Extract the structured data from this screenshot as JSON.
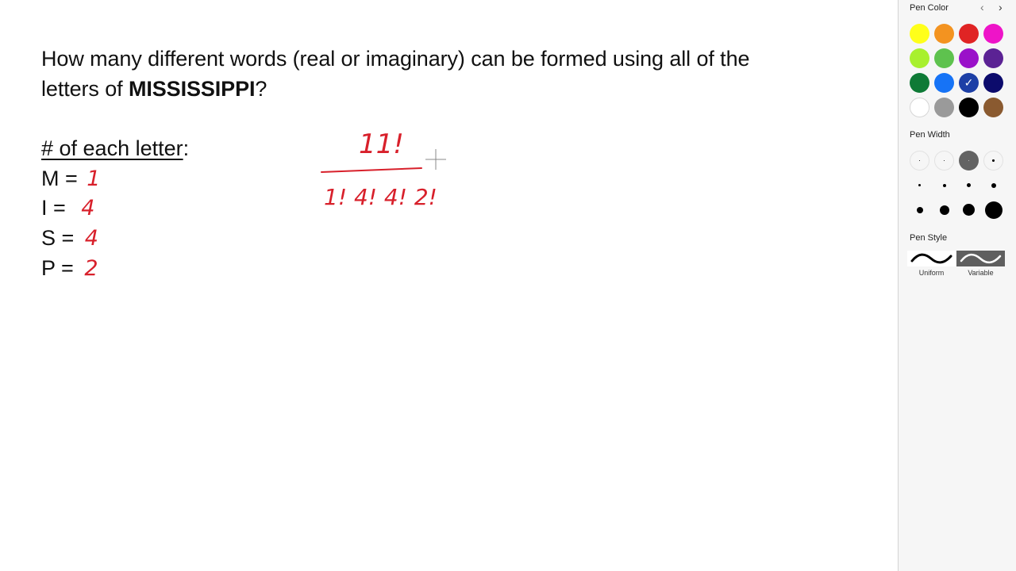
{
  "question": {
    "line1": "How many different words (real or imaginary) can be formed using all of the",
    "line2_prefix": "letters of ",
    "line2_bold": "MISSISSIPPI",
    "line2_suffix": "?"
  },
  "counts": {
    "heading": "# of each letter",
    "heading_colon": ":",
    "rows": [
      {
        "label": "M =",
        "value": "1"
      },
      {
        "label": "I =",
        "value": "4"
      },
      {
        "label": "S =",
        "value": "4"
      },
      {
        "label": "P =",
        "value": "2"
      }
    ]
  },
  "handwriting": {
    "numerator": "11!",
    "denominator": "1! 4! 4! 2!",
    "ink_color": "#d8202b"
  },
  "panel": {
    "pen_color_title": "Pen Color",
    "pen_width_title": "Pen Width",
    "pen_style_title": "Pen Style",
    "colors": [
      [
        "#ffff1a",
        "#f39320",
        "#e02424",
        "#ee14c8"
      ],
      [
        "#a8f02e",
        "#5ec24e",
        "#9a11c9",
        "#5b2294"
      ],
      [
        "#0e7a36",
        "#1673f6",
        "#1d3fa6",
        "#0c0b6c"
      ],
      [
        "#ffffff",
        "#9a9a9a",
        "#000000",
        "#8a5a30"
      ]
    ],
    "selected_color": "#1d3fa6",
    "selected_width_index": 2,
    "styles": [
      {
        "label": "Uniform",
        "selected": false
      },
      {
        "label": "Variable",
        "selected": true
      }
    ]
  }
}
